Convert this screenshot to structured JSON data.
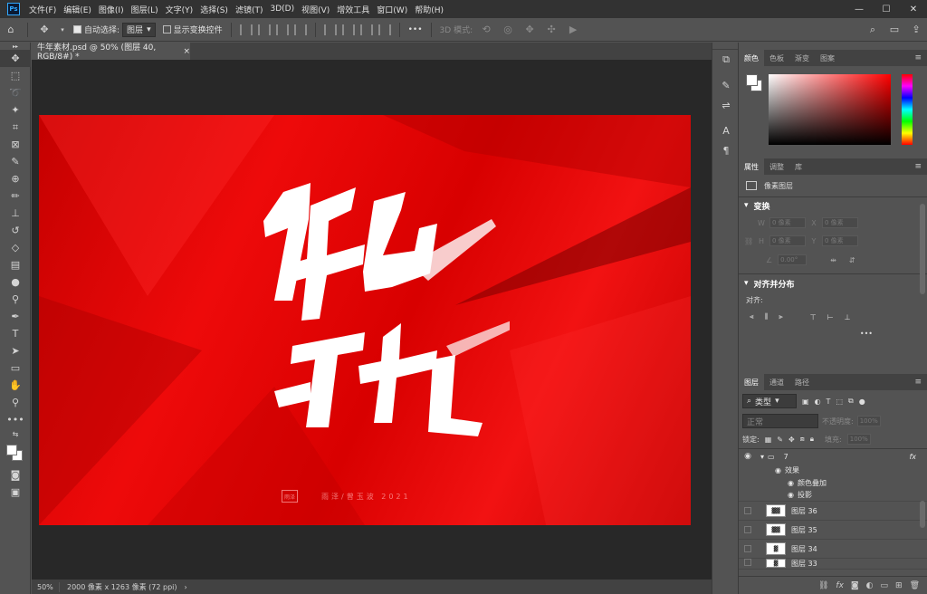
{
  "app": {
    "logo": "Ps"
  },
  "menu": [
    "文件(F)",
    "编辑(E)",
    "图像(I)",
    "图层(L)",
    "文字(Y)",
    "选择(S)",
    "滤镜(T)",
    "3D(D)",
    "视图(V)",
    "增效工具",
    "窗口(W)",
    "帮助(H)"
  ],
  "window_controls": {
    "minimize": "—",
    "maximize": "☐",
    "close": "✕"
  },
  "options": {
    "auto_select_label": "自动选择:",
    "auto_select_value": "图层",
    "show_transform_label": "显示变换控件",
    "mode_3d_label": "3D 模式:",
    "more": "•••"
  },
  "document": {
    "tab_title": "牛年素材.psd @ 50% (图层 40, RGB/8#) *",
    "tab_close": "×",
    "zoom": "50%",
    "doc_info": "2000 像素 x 1263 像素 (72 ppi)",
    "artwork_credit": "雨泽/曾玉波 2021",
    "artwork_seal": "雨泽"
  },
  "color_panel": {
    "tabs": [
      "颜色",
      "色板",
      "渐变",
      "图案"
    ],
    "fg_color": "#ffffff",
    "bg_color": "#ffffff"
  },
  "properties_panel": {
    "tabs": [
      "属性",
      "调整",
      "库"
    ],
    "layer_kind": "像素图层",
    "transform_title": "变换",
    "w_label": "W",
    "w_value": "0 像素",
    "x_label": "X",
    "x_value": "0 像素",
    "h_label": "H",
    "h_value": "0 像素",
    "y_label": "Y",
    "y_value": "0 像素",
    "angle_value": "0.00°",
    "align_title": "对齐并分布",
    "align_label": "对齐:",
    "more": "•••"
  },
  "layers_panel": {
    "tabs": [
      "图层",
      "通道",
      "路径"
    ],
    "filter_label": "类型",
    "blend_mode": "正常",
    "opacity_label": "不透明度:",
    "opacity_value": "100%",
    "lock_label": "锁定:",
    "fill_label": "填充:",
    "fill_value": "100%",
    "group": {
      "name": "7",
      "fx": "fx"
    },
    "effects_label": "效果",
    "effects": [
      "颜色叠加",
      "投影"
    ],
    "layers": [
      "图层 36",
      "图层 35",
      "图层 34",
      "图层 33"
    ],
    "bottom_icons": [
      "link-icon",
      "fx-icon",
      "mask-icon",
      "adjustment-icon",
      "folder-icon",
      "new-layer-icon",
      "trash-icon"
    ],
    "bottom_fx": "fx"
  },
  "colors": {
    "accent": "#31a8ff",
    "artboard_red": "#e80808"
  }
}
